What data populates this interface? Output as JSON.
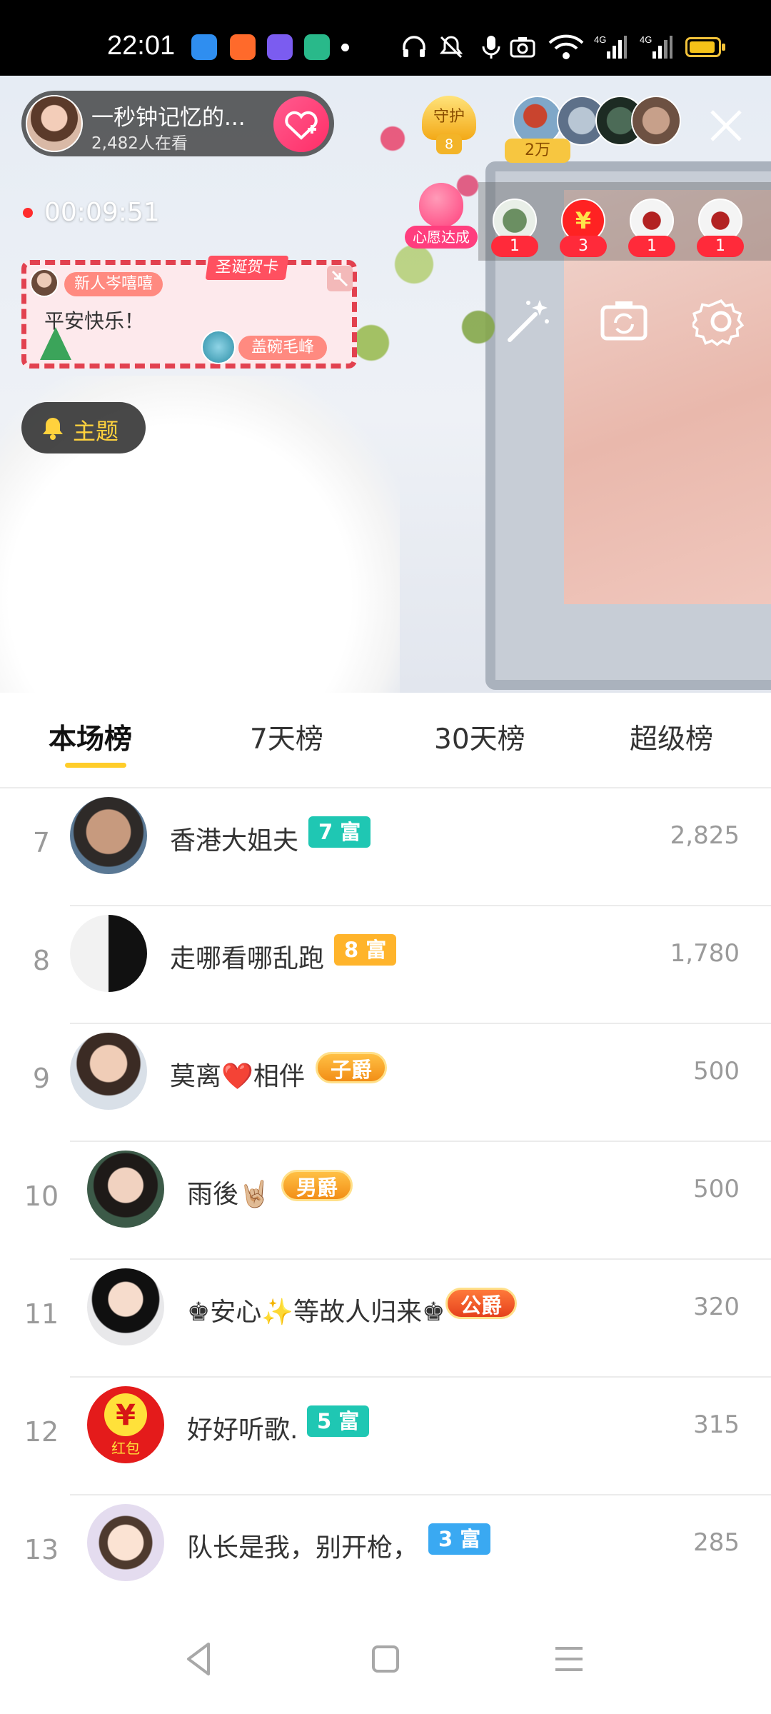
{
  "status_bar": {
    "time": "22:01",
    "icons": [
      "headset-icon",
      "mute-icon",
      "mic-icon",
      "camera-icon",
      "wifi-icon",
      "signal-4g-icon",
      "signal-4g-icon",
      "battery-icon"
    ]
  },
  "live": {
    "host_name": "一秒钟记忆的...",
    "viewer_count": "2,482人在看",
    "follow_icon": "heart-plus-icon",
    "guard_label": "守护",
    "guard_count": "8",
    "top_score": "2万",
    "elapsed": "00:09:51",
    "wish_label": "心愿达成",
    "gift_counts": [
      "1",
      "3",
      "1",
      "1"
    ],
    "red_packet_symbol": "¥",
    "card": {
      "stamp": "圣诞贺卡",
      "sender": "新人岑嘻嘻",
      "message": "平安快乐！",
      "receiver": "盖碗毛峰"
    },
    "topic_label": "主题"
  },
  "tabs": [
    {
      "label": "本场榜",
      "active": true
    },
    {
      "label": "7天榜",
      "active": false
    },
    {
      "label": "30天榜",
      "active": false
    },
    {
      "label": "超级榜",
      "active": false
    }
  ],
  "ranking": [
    {
      "rank": "7",
      "name": "香港大姐夫",
      "badge": "7 富",
      "badge_style": "teal",
      "score": "2,825"
    },
    {
      "rank": "8",
      "name": "走哪看哪乱跑",
      "badge": "8 富",
      "badge_style": "orange",
      "score": "1,780"
    },
    {
      "rank": "9",
      "name": "莫离❤️相伴",
      "badge": "子爵",
      "badge_style": "noble",
      "score": "500"
    },
    {
      "rank": "10",
      "name": "雨後🤘🏼",
      "badge": "男爵",
      "badge_style": "noble",
      "score": "500"
    },
    {
      "rank": "11",
      "name": "♚安心✨等故人归来♚",
      "badge": "公爵",
      "badge_style": "noble-red",
      "score": "320"
    },
    {
      "rank": "12",
      "name": "好好听歌.",
      "badge": "5 富",
      "badge_style": "teal",
      "score": "315"
    },
    {
      "rank": "13",
      "name": "队长是我，别开枪，",
      "badge": "3 富",
      "badge_style": "blue",
      "score": "285"
    }
  ],
  "red_packet_avatar_text": "红包",
  "navbar": [
    "back-icon",
    "home-icon",
    "menu-icon"
  ]
}
